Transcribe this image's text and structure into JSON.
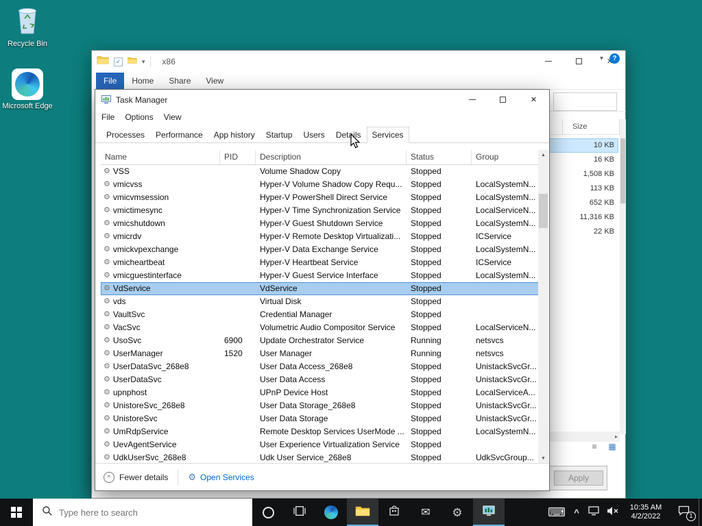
{
  "colors": {
    "desktop_background": "#0d7d7d",
    "taskbar_background": "#101214",
    "accent_blue": "#0078d7",
    "explorer_file_tab_blue": "#2766bb",
    "selection_blue": "#a8cdee",
    "file_selection_blue": "#cce8ff",
    "link_blue": "#0066cc"
  },
  "icons": {
    "service_gear": "⚙",
    "open_services_gear": "⚙",
    "mail": "✉",
    "keyboard": "⌨",
    "close": "✕",
    "chevron_down": "▾",
    "chevron_up": "^",
    "scroll_up": "▲",
    "scroll_down": "▼",
    "scroll_right": "▸",
    "list_view": "≡",
    "grid_view": "▦",
    "help": "?",
    "check": "✓",
    "tray_chevron": "^"
  },
  "desktop": {
    "icons": [
      {
        "label": "Recycle Bin"
      },
      {
        "label": "Microsoft Edge"
      }
    ]
  },
  "explorer": {
    "title": "x86",
    "tabs": [
      {
        "label": "File",
        "accent": true
      },
      {
        "label": "Home"
      },
      {
        "label": "Share"
      },
      {
        "label": "View"
      }
    ],
    "size_header": "Size",
    "sizes": [
      {
        "value": "10 KB",
        "highlighted": true
      },
      {
        "value": "16 KB"
      },
      {
        "value": "1,508 KB"
      },
      {
        "value": "113 KB"
      },
      {
        "value": "652 KB"
      },
      {
        "value": "11,316 KB"
      },
      {
        "value": "22 KB"
      }
    ]
  },
  "dialog": {
    "apply_label": "Apply"
  },
  "task_manager": {
    "title": "Task Manager",
    "menus": [
      {
        "label": "File"
      },
      {
        "label": "Options"
      },
      {
        "label": "View"
      }
    ],
    "tabs": [
      {
        "label": "Processes"
      },
      {
        "label": "Performance"
      },
      {
        "label": "App history"
      },
      {
        "label": "Startup"
      },
      {
        "label": "Users"
      },
      {
        "label": "Details"
      },
      {
        "label": "Services",
        "active": true
      }
    ],
    "columns": [
      {
        "label": "Name"
      },
      {
        "label": "PID"
      },
      {
        "label": "Description"
      },
      {
        "label": "Status"
      },
      {
        "label": "Group"
      }
    ],
    "rows": [
      {
        "name": "VSS",
        "pid": "",
        "description": "Volume Shadow Copy",
        "status": "Stopped",
        "group": ""
      },
      {
        "name": "vmicvss",
        "pid": "",
        "description": "Hyper-V Volume Shadow Copy Requ...",
        "status": "Stopped",
        "group": "LocalSystemN..."
      },
      {
        "name": "vmicvmsession",
        "pid": "",
        "description": "Hyper-V PowerShell Direct Service",
        "status": "Stopped",
        "group": "LocalSystemN..."
      },
      {
        "name": "vmictimesync",
        "pid": "",
        "description": "Hyper-V Time Synchronization Service",
        "status": "Stopped",
        "group": "LocalServiceN..."
      },
      {
        "name": "vmicshutdown",
        "pid": "",
        "description": "Hyper-V Guest Shutdown Service",
        "status": "Stopped",
        "group": "LocalSystemN..."
      },
      {
        "name": "vmicrdv",
        "pid": "",
        "description": "Hyper-V Remote Desktop Virtualizati...",
        "status": "Stopped",
        "group": "ICService"
      },
      {
        "name": "vmickvpexchange",
        "pid": "",
        "description": "Hyper-V Data Exchange Service",
        "status": "Stopped",
        "group": "LocalSystemN..."
      },
      {
        "name": "vmicheartbeat",
        "pid": "",
        "description": "Hyper-V Heartbeat Service",
        "status": "Stopped",
        "group": "ICService"
      },
      {
        "name": "vmicguestinterface",
        "pid": "",
        "description": "Hyper-V Guest Service Interface",
        "status": "Stopped",
        "group": "LocalSystemN..."
      },
      {
        "name": "VdService",
        "pid": "",
        "description": "VdService",
        "status": "Stopped",
        "group": "",
        "selected": true
      },
      {
        "name": "vds",
        "pid": "",
        "description": "Virtual Disk",
        "status": "Stopped",
        "group": ""
      },
      {
        "name": "VaultSvc",
        "pid": "",
        "description": "Credential Manager",
        "status": "Stopped",
        "group": ""
      },
      {
        "name": "VacSvc",
        "pid": "",
        "description": "Volumetric Audio Compositor Service",
        "status": "Stopped",
        "group": "LocalServiceN..."
      },
      {
        "name": "UsoSvc",
        "pid": "6900",
        "description": "Update Orchestrator Service",
        "status": "Running",
        "group": "netsvcs"
      },
      {
        "name": "UserManager",
        "pid": "1520",
        "description": "User Manager",
        "status": "Running",
        "group": "netsvcs"
      },
      {
        "name": "UserDataSvc_268e8",
        "pid": "",
        "description": "User Data Access_268e8",
        "status": "Stopped",
        "group": "UnistackSvcGr..."
      },
      {
        "name": "UserDataSvc",
        "pid": "",
        "description": "User Data Access",
        "status": "Stopped",
        "group": "UnistackSvcGr..."
      },
      {
        "name": "upnphost",
        "pid": "",
        "description": "UPnP Device Host",
        "status": "Stopped",
        "group": "LocalServiceA..."
      },
      {
        "name": "UnistoreSvc_268e8",
        "pid": "",
        "description": "User Data Storage_268e8",
        "status": "Stopped",
        "group": "UnistackSvcGr..."
      },
      {
        "name": "UnistoreSvc",
        "pid": "",
        "description": "User Data Storage",
        "status": "Stopped",
        "group": "UnistackSvcGr..."
      },
      {
        "name": "UmRdpService",
        "pid": "",
        "description": "Remote Desktop Services UserMode ...",
        "status": "Stopped",
        "group": "LocalSystemN..."
      },
      {
        "name": "UevAgentService",
        "pid": "",
        "description": "User Experience Virtualization Service",
        "status": "Stopped",
        "group": ""
      },
      {
        "name": "UdkUserSvc_268e8",
        "pid": "",
        "description": "Udk User Service_268e8",
        "status": "Stopped",
        "group": "UdkSvcGroup..."
      }
    ],
    "footer": {
      "fewer_details": "Fewer details",
      "open_services": "Open Services"
    }
  },
  "taskbar": {
    "search_placeholder": "Type here to search",
    "clock": {
      "time": "10:35 AM",
      "date": "4/2/2022"
    },
    "notification_badge": "1"
  }
}
